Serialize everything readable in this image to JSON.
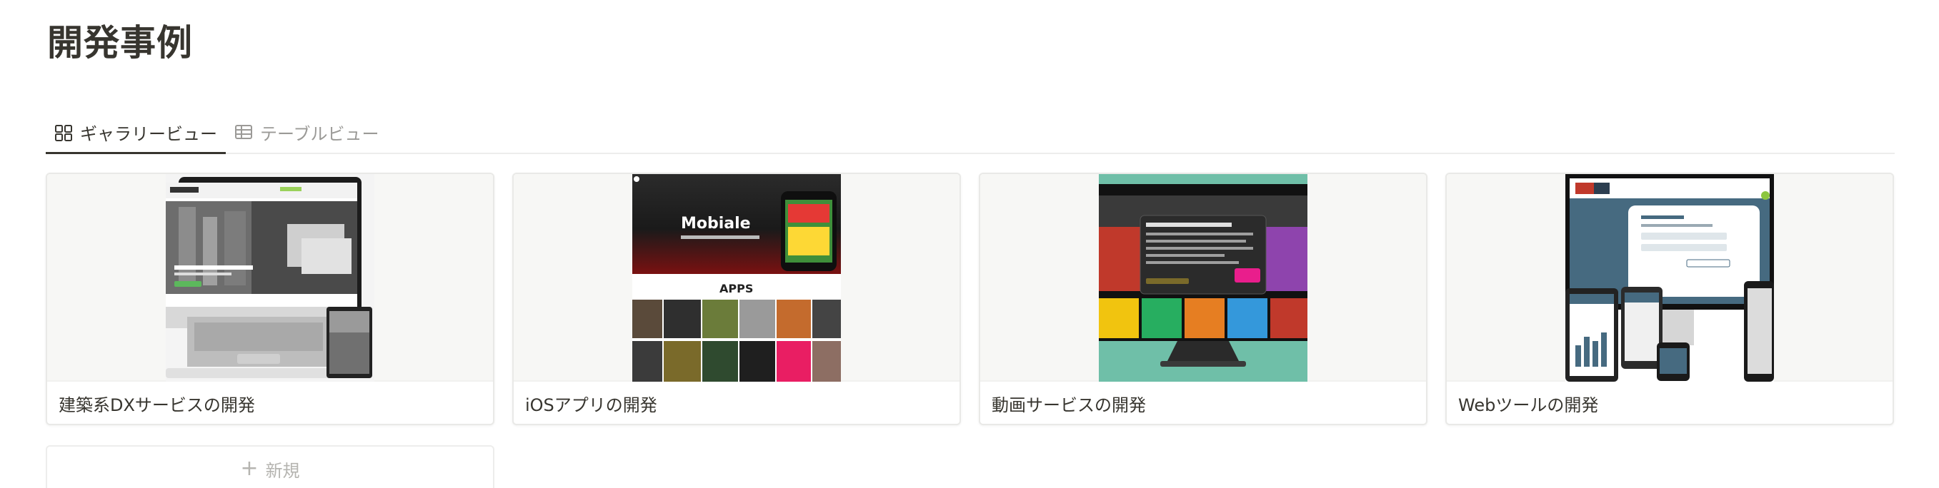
{
  "page": {
    "title": "開発事例"
  },
  "views": {
    "gallery_label": "ギャラリービュー",
    "table_label": "テーブルビュー"
  },
  "cards": [
    {
      "title": "建築系DXサービスの開発",
      "thumbnail": "laptop-architecture-website"
    },
    {
      "title": "iOSアプリの開発",
      "thumbnail": "mobile-app-landing-page"
    },
    {
      "title": "動画サービスの開発",
      "thumbnail": "video-service-monitor"
    },
    {
      "title": "Webツールの開発",
      "thumbnail": "responsive-web-tool-devices"
    }
  ],
  "thumb_text": {
    "mobile_heading": "Mobiale",
    "mobile_sub": "APPS"
  },
  "new_button": {
    "plus": "+",
    "label": "新規"
  }
}
